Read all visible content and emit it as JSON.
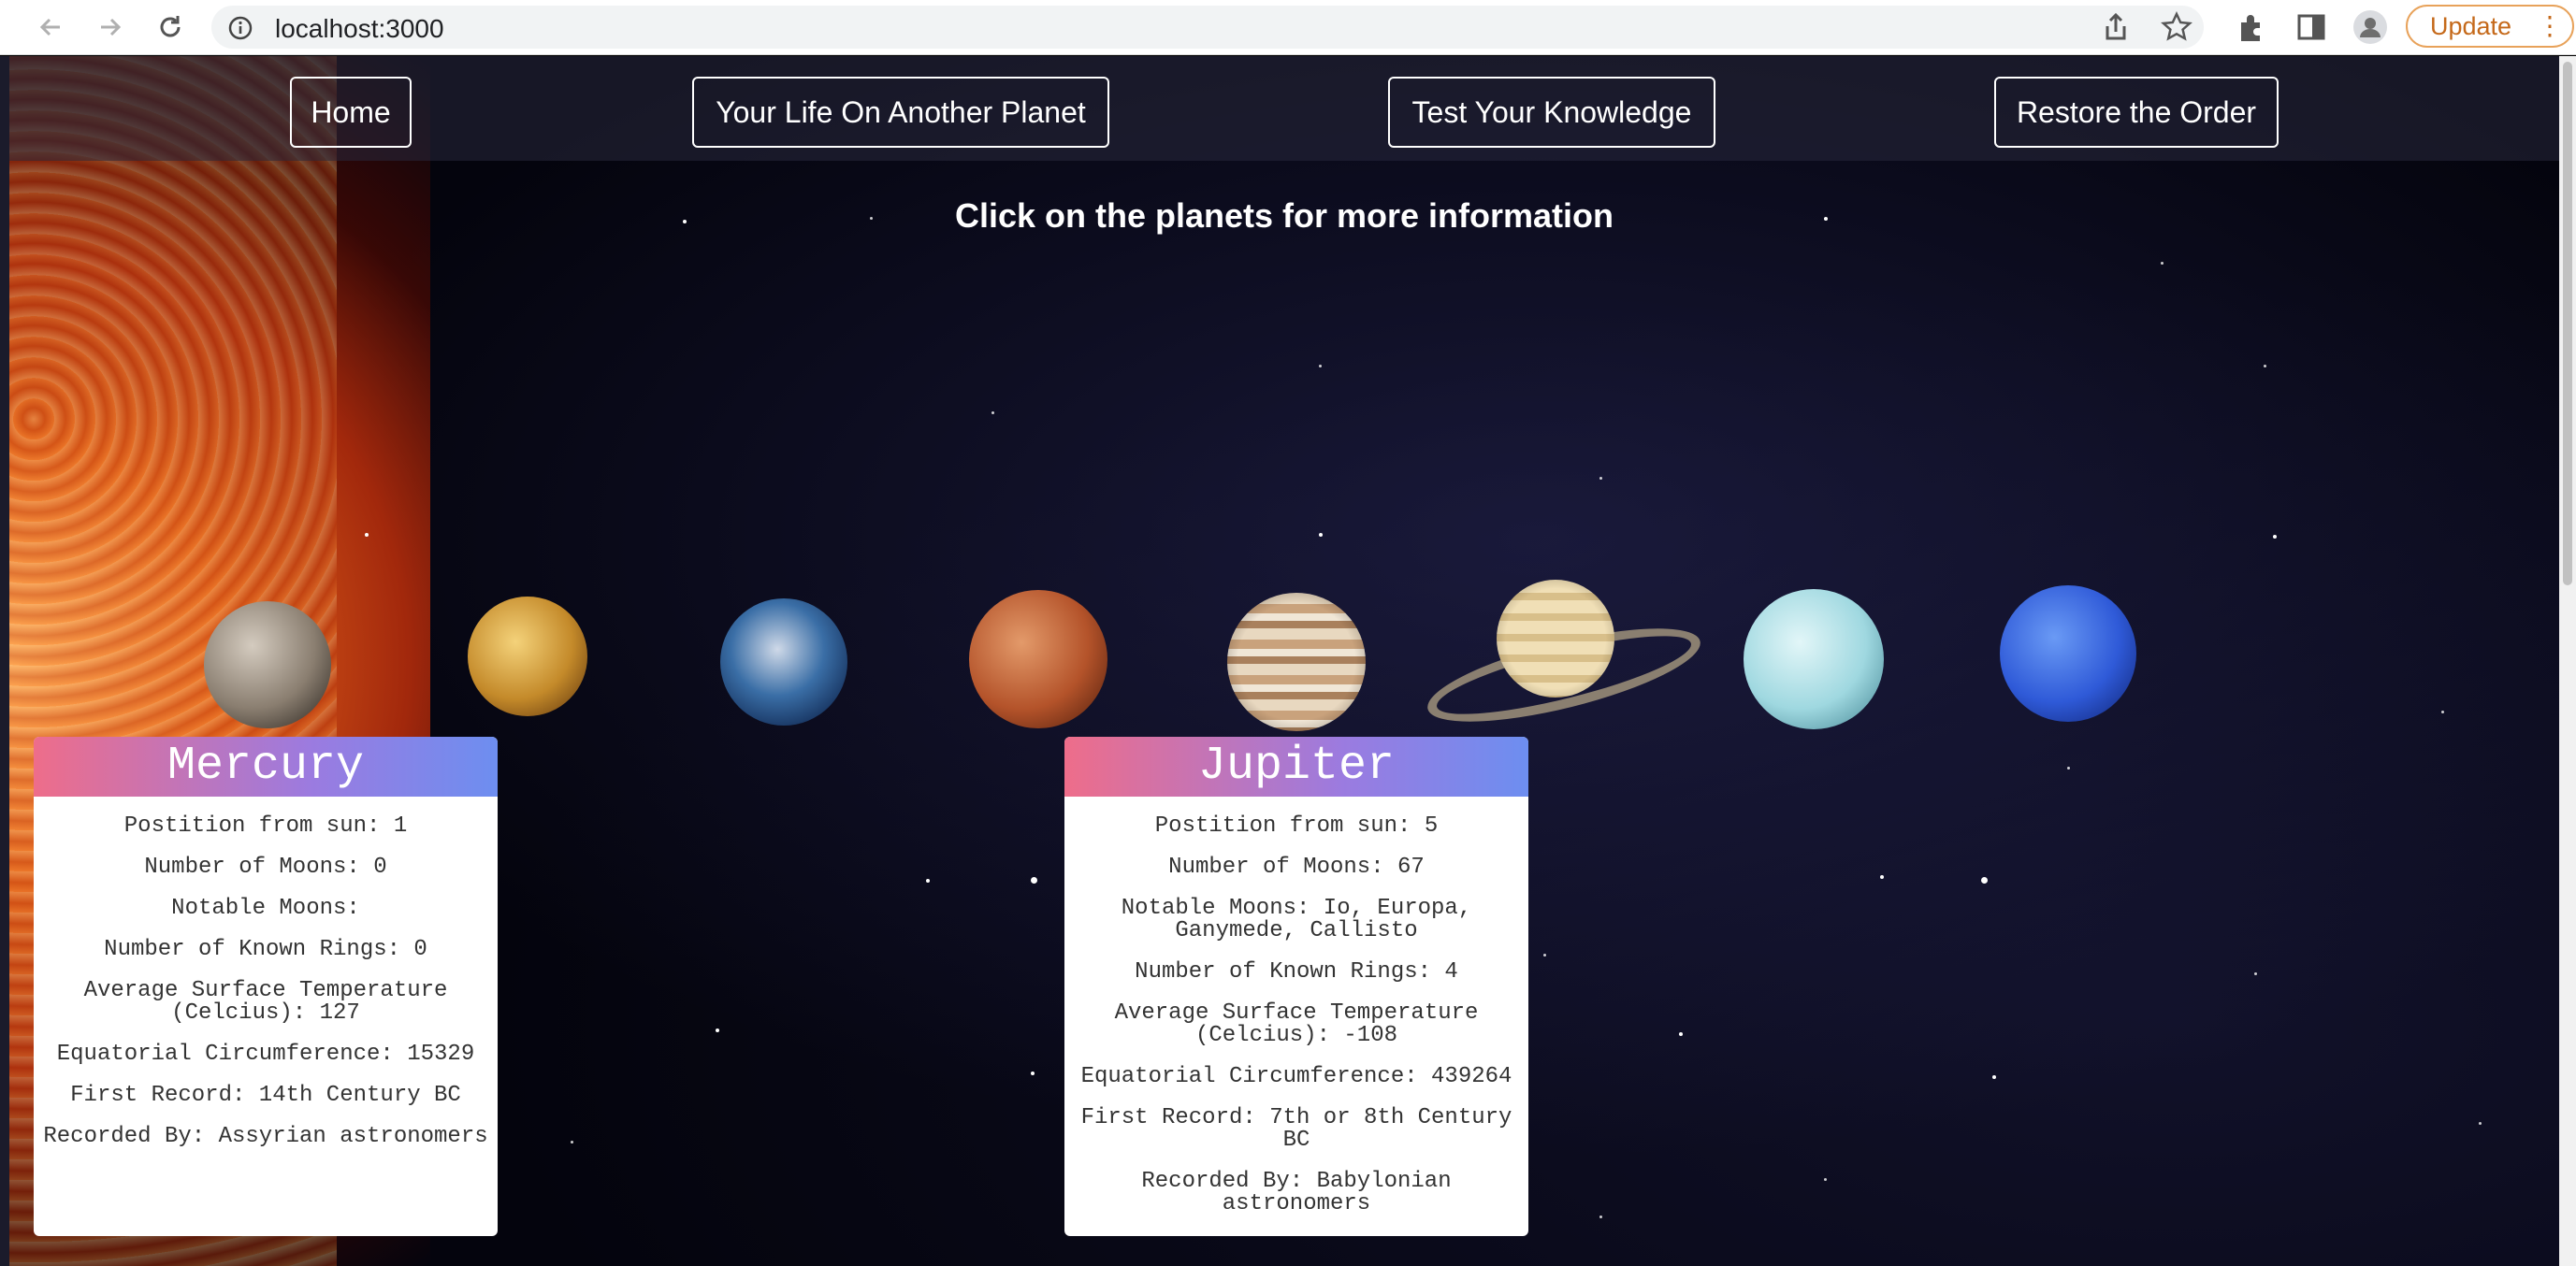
{
  "browser": {
    "url": "localhost:3000",
    "update_label": "Update"
  },
  "nav": {
    "home": "Home",
    "life": "Your Life On Another Planet",
    "test": "Test Your Knowledge",
    "restore": "Restore the Order"
  },
  "instruction": "Click on the planets for more information",
  "planets": [
    "mercury",
    "venus",
    "earth",
    "mars",
    "jupiter",
    "saturn",
    "uranus",
    "neptune"
  ],
  "cards": {
    "mercury": {
      "title": "Mercury",
      "position": "Postition from sun: 1",
      "moons": "Number of Moons: 0",
      "notable": "Notable Moons:",
      "rings": "Number of Known Rings: 0",
      "temp": "Average Surface Temperature (Celcius): 127",
      "circ": "Equatorial Circumference: 15329",
      "first": "First Record: 14th Century BC",
      "recorded": "Recorded By: Assyrian astronomers"
    },
    "jupiter": {
      "title": "Jupiter",
      "position": "Postition from sun: 5",
      "moons": "Number of Moons: 67",
      "notable": "Notable Moons: Io, Europa, Ganymede, Callisto",
      "rings": "Number of Known Rings: 4",
      "temp": "Average Surface Temperature (Celcius): -108",
      "circ": "Equatorial Circumference: 439264",
      "first": "First Record: 7th or 8th Century BC",
      "recorded": "Recorded By: Babylonian astronomers"
    }
  }
}
